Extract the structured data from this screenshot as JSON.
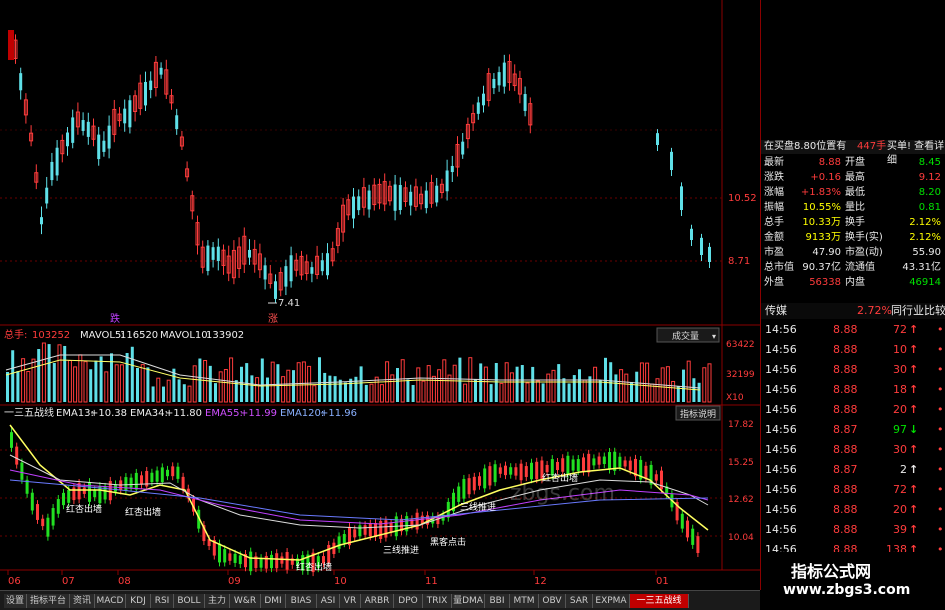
{
  "kline": {
    "price_high_label": "10.52",
    "price_mid_label": "8.71",
    "low_marker": "7.41",
    "marker_left": "跌",
    "marker_right": "涨"
  },
  "volume": {
    "zongshou_label": "总手:",
    "zongshou_value": "103252",
    "mavol5_label": "MAVOL5:",
    "mavol5_value": "116520",
    "mavol10_label": "MAVOL10:",
    "mavol10_value": "133902",
    "axis_top": "63422",
    "axis_mid": "32199",
    "axis_unit": "X10",
    "button": "成交量"
  },
  "indicator": {
    "name": "一三五战线",
    "ema13_label": "EMA13:",
    "ema13_value": "+10.38",
    "ema34_label": "EMA34:",
    "ema34_value": "+11.80",
    "ema55_label": "EMA55:",
    "ema55_value": "+11.99",
    "ema120_label": "EMA120:",
    "ema120_value": "+11.96",
    "help_button": "指标说明",
    "axis": [
      "17.82",
      "15.25",
      "12.62",
      "10.04"
    ],
    "annotations": {
      "a1": "红杏出墙",
      "a2": "红杏出墙",
      "a3": "红杏出墙",
      "a4": "三线推进",
      "a5": "黑客点击",
      "a6": "三线推进",
      "a7": "红杏出墙"
    }
  },
  "xaxis": [
    "06",
    "07",
    "08",
    "09",
    "10",
    "11",
    "12",
    "01"
  ],
  "watermark_text": "zbgs.com",
  "info": {
    "title_left": "在买盘8.80位置有",
    "title_mid": "447手",
    "title_right": "买单! 查看详细",
    "rows": [
      {
        "l1": "最新",
        "v1": "8.88",
        "l2": "开盘",
        "v2": "8.45"
      },
      {
        "l1": "涨跌",
        "v1": "+0.16",
        "l2": "最高",
        "v2": "9.12"
      },
      {
        "l1": "涨幅",
        "v1": "+1.83%",
        "l2": "最低",
        "v2": "8.20"
      },
      {
        "l1": "振幅",
        "v1": "10.55%",
        "l2": "量比",
        "v2": "0.81"
      },
      {
        "l1": "总手",
        "v1": "10.33万",
        "l2": "换手",
        "v2": "2.12%"
      },
      {
        "l1": "金额",
        "v1": "9133万",
        "l2": "换手(实)",
        "v2": "2.12%"
      },
      {
        "l1": "市盈",
        "v1": "47.90",
        "l2": "市盈(动)",
        "v2": "55.90"
      },
      {
        "l1": "总市值",
        "v1": "90.37亿",
        "l2": "流通值",
        "v2": "43.31亿"
      },
      {
        "l1": "外盘",
        "v1": "56338",
        "l2": "内盘",
        "v2": "46914"
      }
    ],
    "industry_label": "传媒",
    "industry_pct": "2.72%",
    "industry_link": "同行业比较"
  },
  "ticks": [
    {
      "t": "14:56",
      "p": "8.88",
      "q": "72",
      "d": "up"
    },
    {
      "t": "14:56",
      "p": "8.88",
      "q": "10",
      "d": "up"
    },
    {
      "t": "14:56",
      "p": "8.88",
      "q": "30",
      "d": "up"
    },
    {
      "t": "14:56",
      "p": "8.88",
      "q": "18",
      "d": "up"
    },
    {
      "t": "14:56",
      "p": "8.88",
      "q": "20",
      "d": "up"
    },
    {
      "t": "14:56",
      "p": "8.87",
      "q": "97",
      "d": "down"
    },
    {
      "t": "14:56",
      "p": "8.88",
      "q": "30",
      "d": "up"
    },
    {
      "t": "14:56",
      "p": "8.87",
      "q": "2",
      "d": "upw"
    },
    {
      "t": "14:56",
      "p": "8.88",
      "q": "72",
      "d": "up"
    },
    {
      "t": "14:56",
      "p": "8.88",
      "q": "20",
      "d": "up"
    },
    {
      "t": "14:56",
      "p": "8.88",
      "q": "39",
      "d": "up"
    },
    {
      "t": "14:56",
      "p": "8.88",
      "q": "138",
      "d": "up"
    }
  ],
  "tabs": [
    "设置",
    "指标平台",
    "资讯",
    "MACD",
    "KDJ",
    "RSI",
    "BOLL",
    "主力",
    "W&R",
    "DMI",
    "BIAS",
    "ASI",
    "VR",
    "ARBR",
    "DPO",
    "TRIX",
    "量DMA",
    "BBI",
    "MTM",
    "OBV",
    "SAR",
    "EXPMA",
    "一三五战线"
  ],
  "footer": {
    "site_name": "指标公式网",
    "site_url": "www.zbgs3.com"
  }
}
